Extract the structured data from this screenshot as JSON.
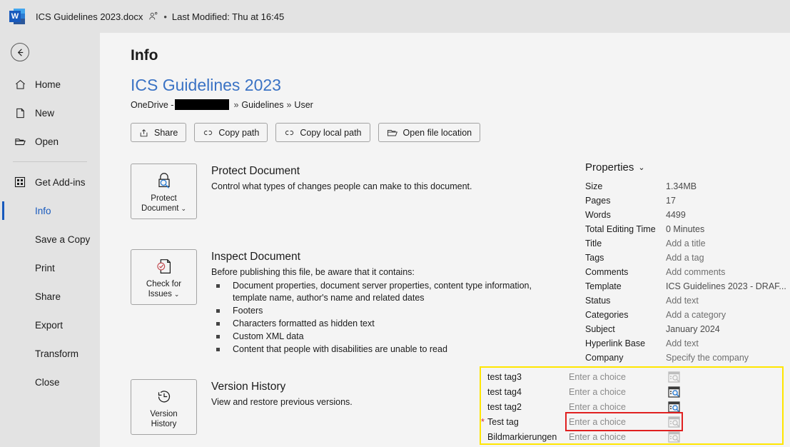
{
  "titlebar": {
    "app_icon": "word-logo-icon",
    "file_name": "ICS Guidelines 2023.docx",
    "people_icon": "person-shared-icon",
    "separator": "•",
    "last_modified": "Last Modified: Thu at 16:45"
  },
  "sidebar": {
    "back_icon": "back-arrow-icon",
    "items": [
      {
        "label": "Home",
        "icon": "home-icon",
        "active": false
      },
      {
        "label": "New",
        "icon": "page-icon",
        "active": false
      },
      {
        "label": "Open",
        "icon": "folder-icon",
        "active": false
      },
      {
        "label": "Get Add-ins",
        "icon": "grid-icon",
        "active": false
      },
      {
        "label": "Info",
        "icon": "",
        "active": true
      },
      {
        "label": "Save a Copy",
        "icon": "",
        "active": false
      },
      {
        "label": "Print",
        "icon": "",
        "active": false
      },
      {
        "label": "Share",
        "icon": "",
        "active": false
      },
      {
        "label": "Export",
        "icon": "",
        "active": false
      },
      {
        "label": "Transform",
        "icon": "",
        "active": false
      },
      {
        "label": "Close",
        "icon": "",
        "active": false
      }
    ]
  },
  "main": {
    "page_title": "Info",
    "document_name": "ICS Guidelines 2023",
    "path_prefix": "OneDrive -",
    "path_redacted": true,
    "path_segment_1": "Guidelines",
    "path_chevron": "»",
    "path_segment_2": "User",
    "actions": [
      {
        "label": "Share",
        "icon": "share-icon"
      },
      {
        "label": "Copy path",
        "icon": "link-icon"
      },
      {
        "label": "Copy local path",
        "icon": "link-icon"
      },
      {
        "label": "Open file location",
        "icon": "open-folder-icon"
      }
    ],
    "features": [
      {
        "tile_label_line1": "Protect",
        "tile_label_line2": "Document",
        "tile_chevron": "⌄",
        "tile_icon": "lock-magnifier-icon",
        "title": "Protect Document",
        "desc": "Control what types of changes people can make to this document.",
        "bullets": []
      },
      {
        "tile_label_line1": "Check for",
        "tile_label_line2": "Issues",
        "tile_chevron": "⌄",
        "tile_icon": "document-check-icon",
        "title": "Inspect Document",
        "desc": "Before publishing this file, be aware that it contains:",
        "bullets": [
          "Document properties, document server properties, content type information, template name, author's name and related dates",
          "Footers",
          "Characters formatted as hidden text",
          "Custom XML data",
          "Content that people with disabilities are unable to read"
        ]
      },
      {
        "tile_label_line1": "Version",
        "tile_label_line2": "History",
        "tile_chevron": "",
        "tile_icon": "clock-history-icon",
        "title": "Version History",
        "desc": "View and restore previous versions.",
        "bullets": []
      }
    ]
  },
  "properties": {
    "header": "Properties",
    "header_chevron": "⌄",
    "rows": [
      {
        "label": "Size",
        "value": "1.34MB",
        "placeholder": false
      },
      {
        "label": "Pages",
        "value": "17",
        "placeholder": false
      },
      {
        "label": "Words",
        "value": "4499",
        "placeholder": false
      },
      {
        "label": "Total Editing Time",
        "value": "0 Minutes",
        "placeholder": false
      },
      {
        "label": "Title",
        "value": "Add a title",
        "placeholder": true
      },
      {
        "label": "Tags",
        "value": "Add a tag",
        "placeholder": true
      },
      {
        "label": "Comments",
        "value": "Add comments",
        "placeholder": true
      },
      {
        "label": "Template",
        "value": "ICS Guidelines 2023 - DRAF...",
        "placeholder": false
      },
      {
        "label": "Status",
        "value": "Add text",
        "placeholder": true
      },
      {
        "label": "Categories",
        "value": "Add a category",
        "placeholder": true
      },
      {
        "label": "Subject",
        "value": "January 2024",
        "placeholder": false
      },
      {
        "label": "Hyperlink Base",
        "value": "Add text",
        "placeholder": true
      },
      {
        "label": "Company",
        "value": "Specify the company",
        "placeholder": true
      }
    ],
    "highlight_color": "#ffe600",
    "selected_outline_color": "#e02020",
    "tag_rows": [
      {
        "label": "test tag3",
        "required": false,
        "value": "Enter a choice",
        "picker_icon": "choice-picker-icon",
        "picker_enabled": false,
        "selected": false
      },
      {
        "label": "test tag4",
        "required": false,
        "value": "Enter a choice",
        "picker_icon": "choice-picker-icon",
        "picker_enabled": true,
        "selected": false
      },
      {
        "label": "test tag2",
        "required": false,
        "value": "Enter a choice",
        "picker_icon": "choice-picker-icon",
        "picker_enabled": true,
        "selected": false
      },
      {
        "label": "Test tag",
        "required": true,
        "value": "Enter a choice",
        "picker_icon": "choice-picker-icon",
        "picker_enabled": false,
        "selected": true
      },
      {
        "label": "Bildmarkierungen",
        "required": false,
        "value": "Enter a choice",
        "picker_icon": "choice-picker-icon",
        "picker_enabled": false,
        "selected": false
      }
    ],
    "required_marker": "*"
  }
}
